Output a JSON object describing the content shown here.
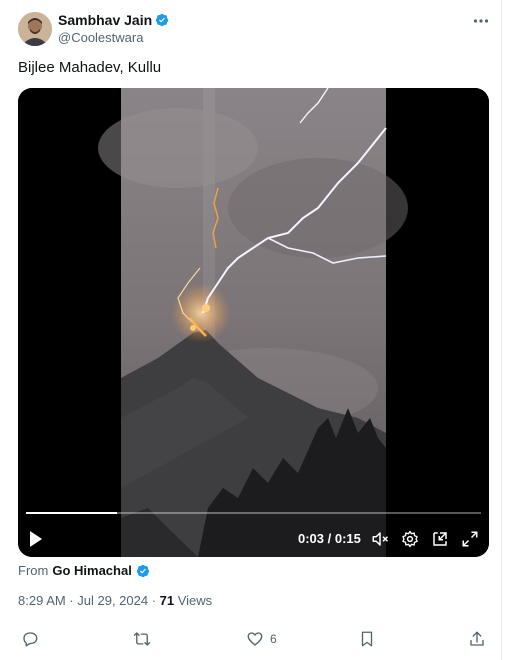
{
  "author": {
    "name": "Sambhav Jain",
    "handle": "@Coolestwara",
    "verified": true
  },
  "post": {
    "text": "Bijlee Mahadev, Kullu"
  },
  "video": {
    "time_display": "0:03 / 0:15",
    "progress": 0.2
  },
  "source": {
    "from_label": "From",
    "name": "Go Himachal",
    "verified": true
  },
  "meta": {
    "time_date": "8:29 AM · Jul 29, 2024 · ",
    "views_count": "71",
    "views_label": " Views"
  },
  "actions": {
    "like_count": "6"
  },
  "colors": {
    "verified_blue": "#1d9bf0",
    "muted_text": "#536471",
    "text": "#0f1419"
  },
  "icons": [
    "more-icon",
    "verified-icon",
    "play-icon",
    "mute-icon",
    "settings-icon",
    "pip-icon",
    "fullscreen-icon",
    "reply-icon",
    "repost-icon",
    "like-icon",
    "bookmark-icon",
    "share-icon"
  ]
}
